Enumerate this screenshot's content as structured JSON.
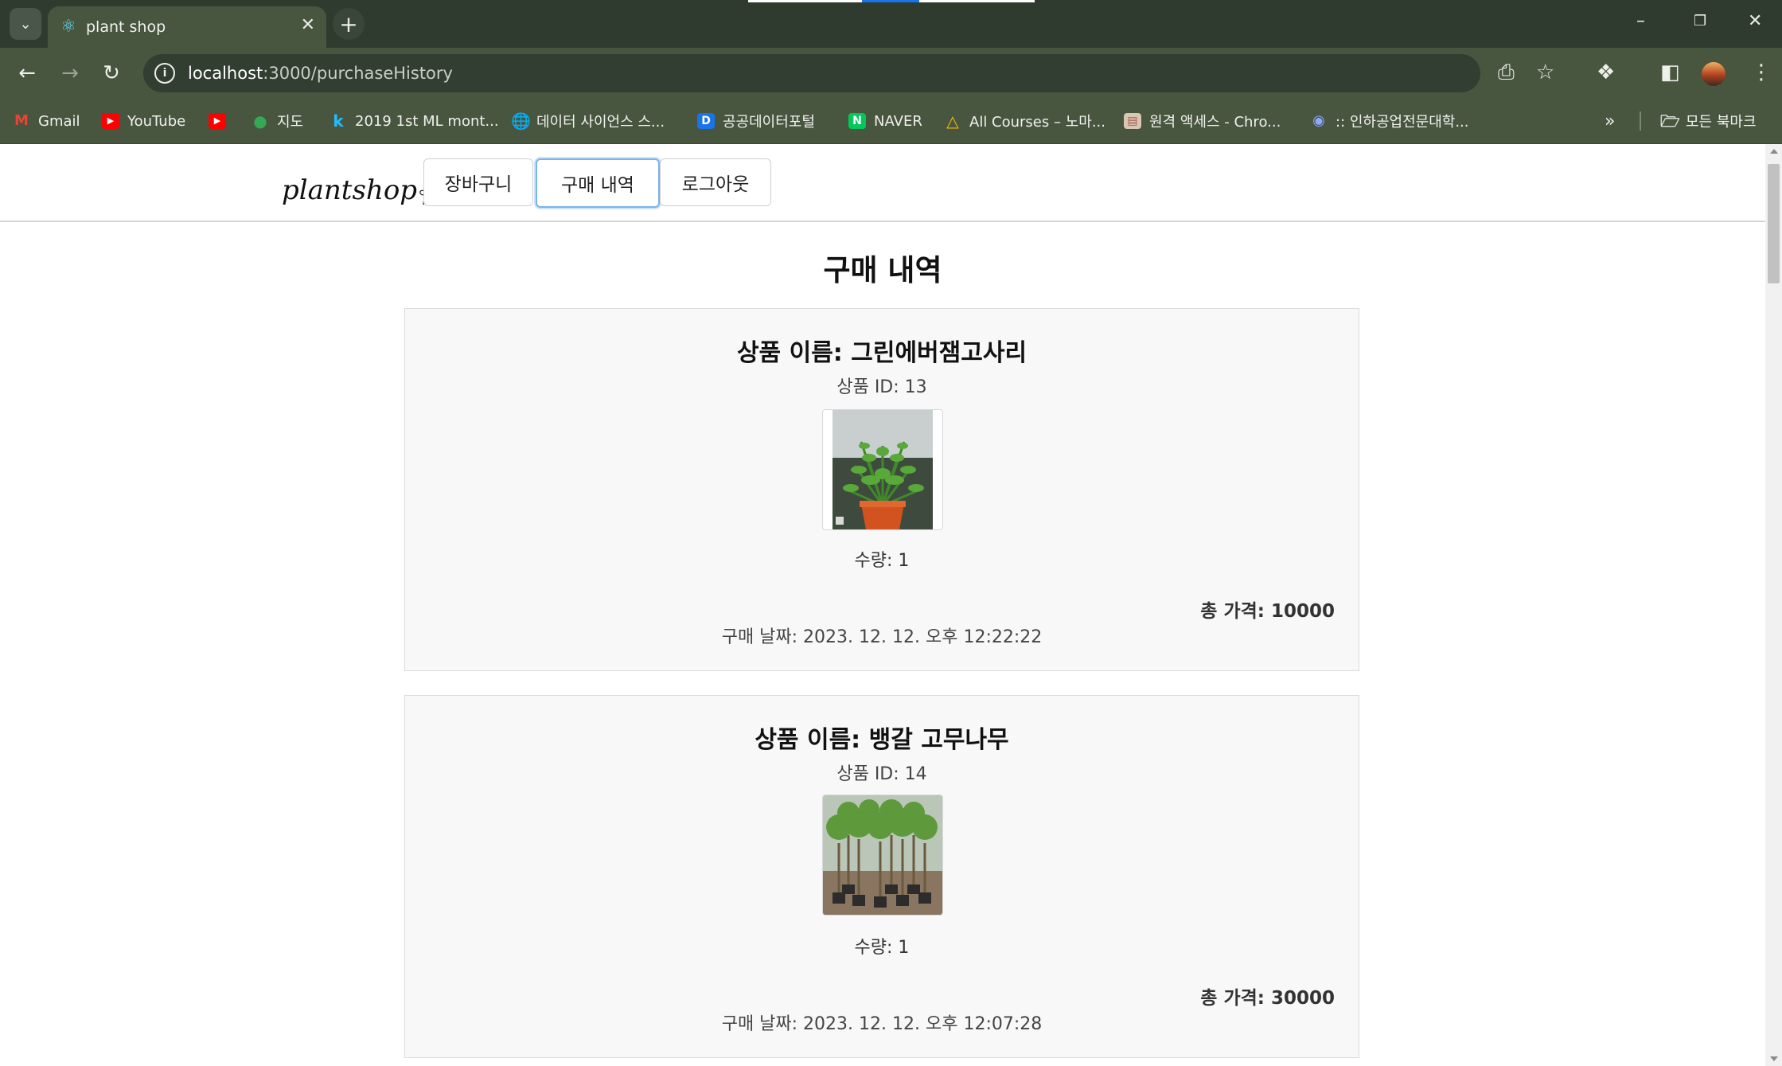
{
  "browser": {
    "tab_title": "plant shop",
    "url_host": "localhost",
    "url_path": ":3000/purchaseHistory",
    "bookmarks": [
      {
        "label": "Gmail",
        "icon": "gmail-icon",
        "color": "#ea4335"
      },
      {
        "label": "YouTube",
        "icon": "youtube-icon",
        "color": "#ff0000"
      },
      {
        "label": "",
        "icon": "youtube-icon",
        "color": "#ff0000"
      },
      {
        "label": "지도",
        "icon": "maps-icon",
        "color": "#34a853"
      },
      {
        "label": "2019 1st ML mont...",
        "icon": "k-icon",
        "color": "#20beff"
      },
      {
        "label": "데이터 사이언스 스...",
        "icon": "globe-icon",
        "color": "#ffffff"
      },
      {
        "label": "공공데이터포털",
        "icon": "d-icon",
        "color": "#1a73e8"
      },
      {
        "label": "NAVER",
        "icon": "naver-icon",
        "color": "#03c75a"
      },
      {
        "label": "All Courses – 노마...",
        "icon": "nomad-icon",
        "color": "#f6c000"
      },
      {
        "label": "원격 액세스 - Chro...",
        "icon": "remote-icon",
        "color": "#e0e0e0"
      },
      {
        "label": ":: 인하공업전문대학...",
        "icon": "school-icon",
        "color": "#3b5fc0"
      }
    ],
    "more_bookmarks": "»",
    "all_bookmarks": "모든 북마크"
  },
  "site": {
    "logo": "plantshop",
    "nav": [
      "장바구니",
      "구매 내역",
      "로그아웃"
    ],
    "active_nav": "구매 내역"
  },
  "page": {
    "title": "구매 내역",
    "purchases": [
      {
        "name": "상품 이름: 그린에버잼고사리",
        "id": "상품 ID: 13",
        "qty": "수량: 1",
        "total": "총 가격: 10000",
        "date": "구매 날짜: 2023. 12. 12. 오후 12:22:22"
      },
      {
        "name": "상품 이름: 뱅갈 고무나무",
        "id": "상품 ID: 14",
        "qty": "수량: 1",
        "total": "총 가격: 30000",
        "date": "구매 날짜: 2023. 12. 12. 오후 12:07:28"
      }
    ]
  }
}
